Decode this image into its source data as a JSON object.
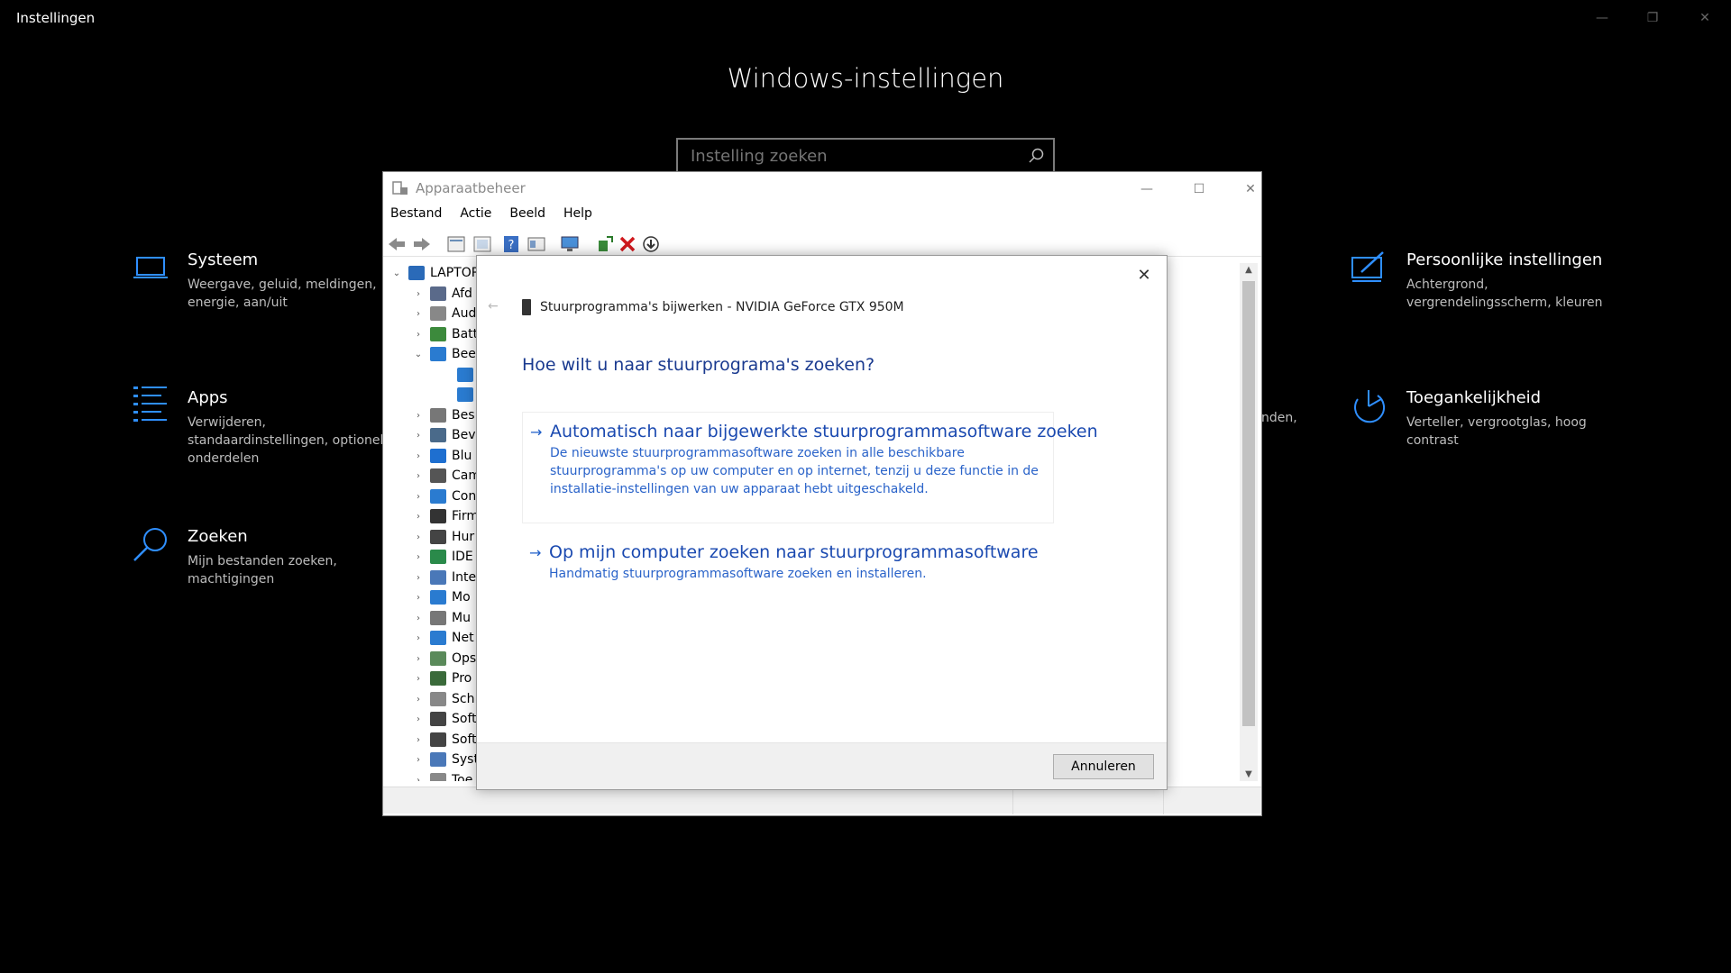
{
  "settings": {
    "window_title": "Instellingen",
    "heading": "Windows-instellingen",
    "search_placeholder": "Instelling zoeken",
    "categories": [
      {
        "title": "Systeem",
        "desc": "Weergave, geluid, meldingen, energie, aan/uit",
        "icon": "laptop-icon"
      },
      {
        "title": "Apps",
        "desc": "Verwijderen, standaardinstellingen, optionele onderdelen",
        "icon": "apps-list-icon"
      },
      {
        "title": "Zoeken",
        "desc": "Mijn bestanden zoeken, machtigingen",
        "icon": "search-icon"
      },
      {
        "title": "Persoonlijke instellingen",
        "desc": "Achtergrond, vergrendelingsscherm, kleuren",
        "icon": "paint-icon"
      },
      {
        "title": "Toegankelijkheid",
        "desc": "Verteller, vergrootglas, hoog contrast",
        "icon": "accessibility-icon"
      }
    ],
    "partial_text": "nden,"
  },
  "devmgr": {
    "title": "Apparaatbeheer",
    "menu": [
      "Bestand",
      "Actie",
      "Beeld",
      "Help"
    ],
    "tree_root": "LAPTOP",
    "tree_items": [
      "Afd",
      "Aud",
      "Batt",
      "Bee",
      "",
      "",
      "Bes",
      "Bev",
      "Blu",
      "Cam",
      "Con",
      "Firm",
      "Hur",
      "IDE",
      "Inte",
      "Mo",
      "Mu",
      "Net",
      "Ops",
      "Pro",
      "Sch",
      "Soft",
      "Soft",
      "Syst",
      "Toe"
    ]
  },
  "dialog": {
    "caption": "Stuurprogramma's bijwerken - NVIDIA GeForce GTX 950M",
    "heading": "Hoe wilt u naar stuurprograma's zoeken?",
    "option1_title": "Automatisch naar bijgewerkte stuurprogrammasoftware zoeken",
    "option1_desc": "De nieuwste stuurprogrammasoftware zoeken in alle beschikbare stuurprogramma's op uw computer en op internet, tenzij u deze functie in de installatie-instellingen van uw apparaat hebt uitgeschakeld.",
    "option2_title": "Op mijn computer zoeken naar stuurprogrammasoftware",
    "option2_desc": "Handmatig stuurprogrammasoftware zoeken en installeren.",
    "cancel_label": "Annuleren"
  },
  "colors": {
    "accent": "#1a73e8",
    "settings_bg": "#000000",
    "link_blue": "#1a49b0"
  }
}
